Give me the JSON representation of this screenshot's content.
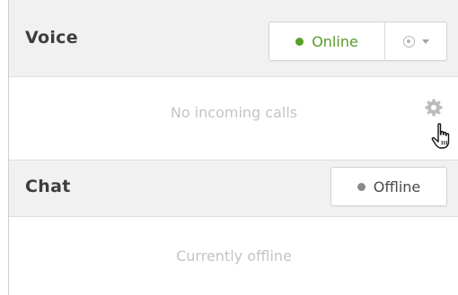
{
  "voice": {
    "title": "Voice",
    "status_label": "Online",
    "status_color": "#58a02a",
    "dropdown_icon": "status-options-icon",
    "empty_message": "No incoming calls",
    "settings_icon": "gear-icon"
  },
  "chat": {
    "title": "Chat",
    "status_label": "Offline",
    "status_color": "#8a8a8a",
    "empty_message": "Currently offline"
  },
  "cursor": {
    "icon": "hand-pointer-cursor"
  }
}
